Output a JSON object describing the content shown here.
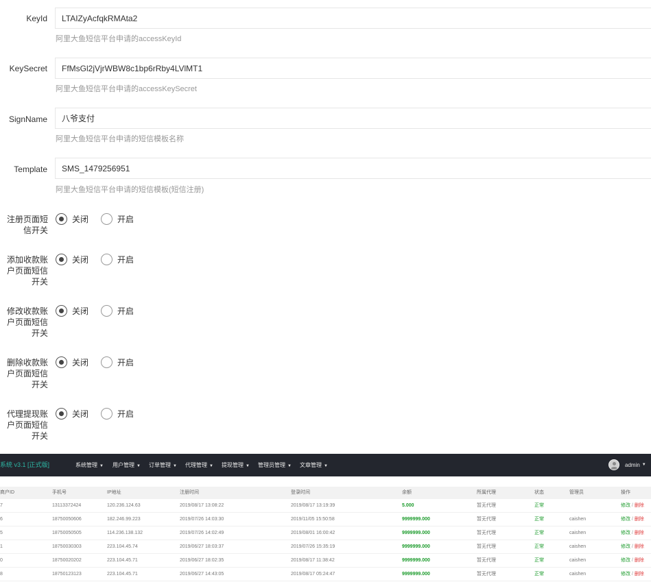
{
  "fields": [
    {
      "label": "KeyId",
      "value": "LTAIZyAcfqkRMAta2",
      "hint": "阿里大鱼短信平台申请的accessKeyId"
    },
    {
      "label": "KeySecret",
      "value": "FfMsGl2jVjrWBW8c1bp6rRby4LVlMT1",
      "hint": "阿里大鱼短信平台申请的accessKeySecret"
    },
    {
      "label": "SignName",
      "value": "八爷支付",
      "hint": "阿里大鱼短信平台申请的短信模板名称"
    },
    {
      "label": "Template",
      "value": "SMS_1479256951",
      "hint": "阿里大鱼短信平台申请的短信模板(短信注册)"
    }
  ],
  "switches": [
    {
      "label": "注册页面短信开关",
      "off_label": "关闭",
      "on_label": "开启",
      "selected": "off"
    },
    {
      "label": "添加收款账户页面短信开关",
      "off_label": "关闭",
      "on_label": "开启",
      "selected": "off"
    },
    {
      "label": "修改收款账户页面短信开关",
      "off_label": "关闭",
      "on_label": "开启",
      "selected": "off"
    },
    {
      "label": "删除收款账户页面短信开关",
      "off_label": "关闭",
      "on_label": "开启",
      "selected": "off"
    },
    {
      "label": "代理提现账户页面短信开关",
      "off_label": "关闭",
      "on_label": "开启",
      "selected": "off"
    }
  ],
  "admin": {
    "brand": "系统 v3.1 [正式版]",
    "menu": [
      "系统管理",
      "用户管理",
      "订单管理",
      "代理管理",
      "提现管理",
      "管理员管理",
      "文章管理"
    ],
    "user": "admin",
    "columns": [
      "商户ID",
      "手机号",
      "IP地址",
      "注册时间",
      "登录时间",
      "余额",
      "所属代理",
      "状态",
      "管理员",
      "操作"
    ],
    "rows": [
      {
        "id": "7",
        "phone": "13113372424",
        "ip": "120.236.124.63",
        "reg": "2019/08/17 13:08:22",
        "login": "2019/08/17 13:19:39",
        "balance": "5.000",
        "agent": "暂无代理",
        "status": "正常",
        "admin": "",
        "edit": "修改",
        "del": "删除"
      },
      {
        "id": "6",
        "phone": "18750050606",
        "ip": "182.246.99.223",
        "reg": "2019/07/26 14:03:30",
        "login": "2019/11/05 15:50:58",
        "balance": "9999999.000",
        "agent": "暂无代理",
        "status": "正常",
        "admin": "caishen",
        "edit": "修改",
        "del": "删除"
      },
      {
        "id": "5",
        "phone": "18750050505",
        "ip": "114.236.138.132",
        "reg": "2019/07/26 14:02:49",
        "login": "2019/08/01 16:00:42",
        "balance": "9999999.000",
        "agent": "暂无代理",
        "status": "正常",
        "admin": "caishen",
        "edit": "修改",
        "del": "删除"
      },
      {
        "id": "1",
        "phone": "18750030303",
        "ip": "223.104.45.74",
        "reg": "2019/06/27 18:03:37",
        "login": "2019/07/26 15:35:19",
        "balance": "9999999.000",
        "agent": "暂无代理",
        "status": "正常",
        "admin": "caishen",
        "edit": "修改",
        "del": "删除"
      },
      {
        "id": "0",
        "phone": "18750020202",
        "ip": "223.104.45.71",
        "reg": "2019/06/27 18:02:35",
        "login": "2019/08/17 11:38:42",
        "balance": "9999999.000",
        "agent": "暂无代理",
        "status": "正常",
        "admin": "caishen",
        "edit": "修改",
        "del": "删除"
      },
      {
        "id": "8",
        "phone": "18750123123",
        "ip": "223.104.45.71",
        "reg": "2019/06/27 14:43:05",
        "login": "2019/08/17 05:24:47",
        "balance": "9999999.000",
        "agent": "暂无代理",
        "status": "正常",
        "admin": "caishen",
        "edit": "修改",
        "del": "删除"
      }
    ]
  }
}
